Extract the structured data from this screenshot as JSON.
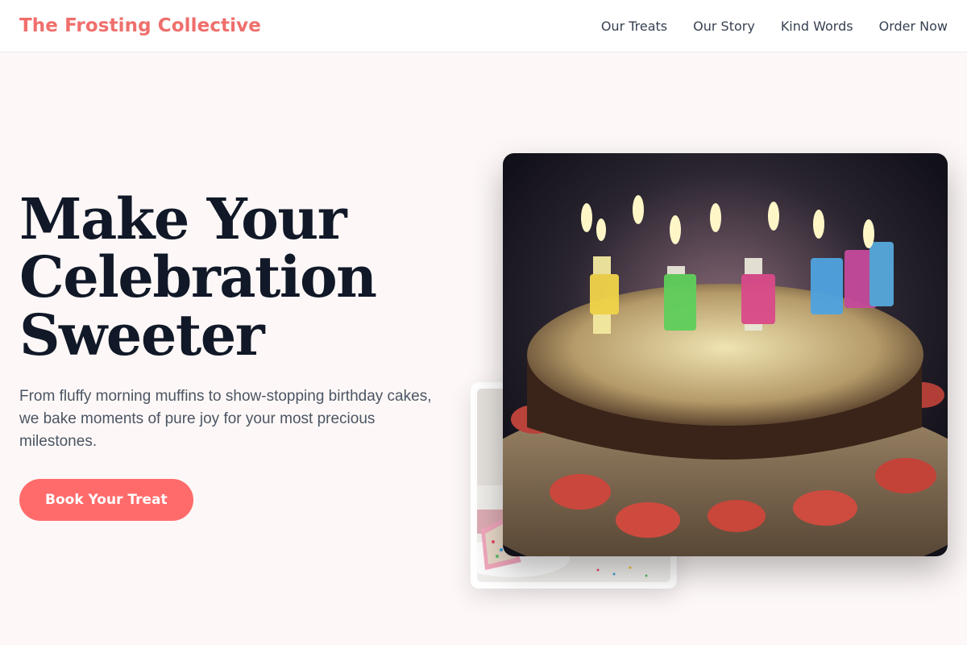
{
  "header": {
    "brand": "The Frosting Collective",
    "nav": [
      "Our Treats",
      "Our Story",
      "Kind Words",
      "Order Now"
    ]
  },
  "hero": {
    "title_lines": [
      "Make Your",
      "Celebration",
      "Sweeter"
    ],
    "subtitle": "From fluffy morning muffins to show-stopping birthday cakes, we bake moments of pure joy for your most precious milestones.",
    "cta_label": "Book Your Treat"
  },
  "images": {
    "main": {
      "candle_letters": [
        "H",
        "A",
        "P",
        "P",
        "Y",
        "B",
        "I",
        "R",
        "T",
        "H",
        "D",
        "A",
        "Y"
      ]
    }
  },
  "colors": {
    "brand": "#ef6f6c",
    "cta": "#ff6b6b",
    "background": "#fdf8f7"
  }
}
